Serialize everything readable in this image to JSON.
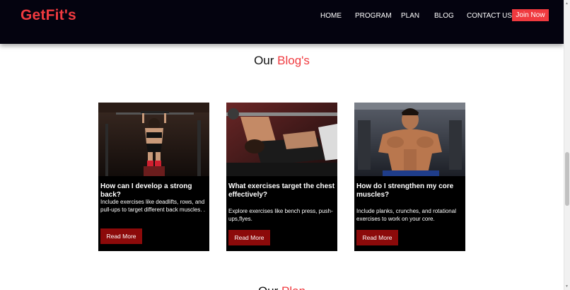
{
  "nav": {
    "brand": "GetFit's",
    "links": [
      "HOME",
      "PROGRAM",
      "PLAN",
      "BLOG",
      "CONTACT US"
    ],
    "join_label": "Join Now"
  },
  "section": {
    "title_prefix": "Our",
    "title_accent": "Blog's"
  },
  "cards": [
    {
      "title": "How can I develop a strong back?",
      "text": "Include exercises like deadlifts, rows, and pull-ups to target different back muscles. .",
      "button": "Read More"
    },
    {
      "title": "What exercises target the chest effectively?",
      "text": "Explore exercises like bench press, push-ups,flyes.",
      "button": "Read More"
    },
    {
      "title": "How do I strengthen my core muscles?",
      "text": "Include planks, crunches, and rotational exercises to work on your core.",
      "button": "Read More"
    }
  ],
  "bottom_section": {
    "title_prefix": "Our",
    "title_accent": "Plan"
  },
  "colors": {
    "accent": "#f03a3f",
    "nav_bg": "#04030f",
    "card_bg": "#000000",
    "button_bg": "#8c0a0a"
  }
}
